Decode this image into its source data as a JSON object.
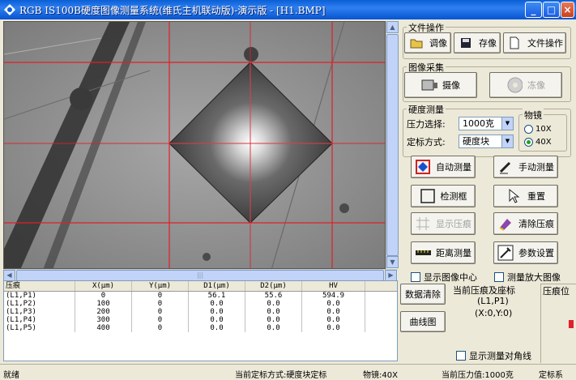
{
  "window": {
    "title": "RGB IS100B硬度图像测量系统(维氏主机联动版)-演示版 - [H1.BMP]",
    "min": "_",
    "max": "□",
    "close": "×"
  },
  "file_group": {
    "label": "文件操作",
    "load": "调像",
    "save": "存像",
    "file_ops": "文件操作"
  },
  "capture_group": {
    "label": "图像采集",
    "capture": "摄像",
    "freeze": "冻像"
  },
  "hardness_group": {
    "label": "硬度测量",
    "force_label": "压力选择:",
    "force_value": "1000克",
    "calib_label": "定标方式:",
    "calib_value": "硬度块"
  },
  "objective": {
    "label": "物镜",
    "options": [
      "10X",
      "40X"
    ],
    "selected": "40X"
  },
  "tools": {
    "auto": "自动测量",
    "manual": "手动测量",
    "detect": "检测框",
    "reset": "重置",
    "show_indent": "显示压痕",
    "clear_indent": "清除压痕",
    "distance": "距离测量",
    "params": "参数设置"
  },
  "options": {
    "show_center": "显示图像中心",
    "zoom": "测量放大图像",
    "show_diag": "显示测量对角线"
  },
  "table": {
    "headers": [
      "压痕",
      "X(μm)",
      "Y(μm)",
      "D1(μm)",
      "D2(μm)",
      "HV"
    ],
    "rows": [
      [
        "(L1,P1)",
        "0",
        "0",
        "56.1",
        "55.6",
        "594.9"
      ],
      [
        "(L1,P2)",
        "100",
        "0",
        "0.0",
        "0.0",
        "0.0"
      ],
      [
        "(L1,P3)",
        "200",
        "0",
        "0.0",
        "0.0",
        "0.0"
      ],
      [
        "(L1,P4)",
        "300",
        "0",
        "0.0",
        "0.0",
        "0.0"
      ],
      [
        "(L1,P5)",
        "400",
        "0",
        "0.0",
        "0.0",
        "0.0"
      ]
    ]
  },
  "side": {
    "clear_data": "数据清除",
    "curve": "曲线图",
    "current_title": "当前压痕及座标",
    "current_id": "(L1,P1)",
    "current_xy": "(X:0,Y:0)",
    "indent_pos": "压痕位"
  },
  "status": {
    "ready": "就绪",
    "calib": "当前定标方式:硬度块定标",
    "objective": "物镜:40X",
    "force": "当前压力值:1000克",
    "calib2": "定标系"
  },
  "colors": {
    "title_bar": "#0a5fd6",
    "overlay_line": "#e0202a"
  }
}
